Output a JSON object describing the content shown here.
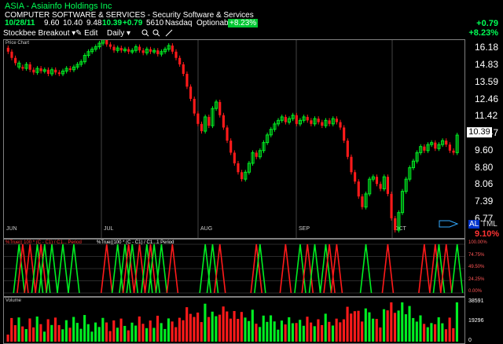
{
  "header": {
    "title": "ASIA - Asiainfo Holdings Inc",
    "sector": "COMPUTER SOFTWARE & SERVICES - Security Software & Services",
    "date": "10/28/11",
    "open": "9.60",
    "high": "10.40",
    "low": "9.48",
    "close": "10.39",
    "change": "+0.79",
    "volume": "5610",
    "exchange": "Nasdaq",
    "optionable": "Optionable",
    "pct_badge": "+8.23%",
    "change_right": "+0.79",
    "pct_right": "+8.23%"
  },
  "toolbar": {
    "layout": "Stockbee Breakout",
    "edit": "Edit",
    "period": "Daily",
    "icons": [
      "chevron-down-icon",
      "pencil-icon",
      "chevron-down-icon",
      "zoom-in-icon",
      "zoom-out-icon",
      "draw-line-icon"
    ]
  },
  "price_pane": {
    "label": "Price Chart",
    "price_tag": "10.39",
    "al": "AL",
    "tml": "TML",
    "pct": "9.10%"
  },
  "indicator_pane": {
    "label_red": "%True(( 100 * (C - C1) / C1... Period",
    "label_green": "%True((100 * (C - C1) / C1...1 Period",
    "levels": [
      "100.00%",
      "74.75%",
      "49.50%",
      "24.25%",
      "0.00%"
    ]
  },
  "volume_pane": {
    "label": "Volume",
    "levels": [
      "38591",
      "19296",
      "0"
    ]
  },
  "colors": {
    "up": "#00ee22",
    "down": "#ff1a1a",
    "text_green": "#00ff55"
  },
  "chart_data": {
    "type": "candlestick",
    "months": [
      "JUN",
      "JUL",
      "AUG",
      "SEP",
      "OCT"
    ],
    "y_ticks": [
      "16.18",
      "14.83",
      "13.59",
      "12.46",
      "11.42",
      "10.47",
      "9.60",
      "8.80",
      "8.06",
      "7.39",
      "6.77"
    ],
    "y_tick_values": [
      16.18,
      14.83,
      13.59,
      12.46,
      11.42,
      10.47,
      9.6,
      8.8,
      8.06,
      7.39,
      6.77
    ],
    "log_scale": true,
    "series_close": [
      15.9,
      15.4,
      15.0,
      14.7,
      14.6,
      14.9,
      14.5,
      14.3,
      14.6,
      14.4,
      14.5,
      14.2,
      14.5,
      14.3,
      14.2,
      14.4,
      14.6,
      14.5,
      14.7,
      14.9,
      15.1,
      15.6,
      15.9,
      16.1,
      16.3,
      16.6,
      16.9,
      16.5,
      16.3,
      16.0,
      16.2,
      16.0,
      16.1,
      15.9,
      16.0,
      16.3,
      16.0,
      15.8,
      16.1,
      15.9,
      16.0,
      15.7,
      15.9,
      16.1,
      16.4,
      15.9,
      15.4,
      14.9,
      14.2,
      13.3,
      12.5,
      11.6,
      11.0,
      10.6,
      11.4,
      10.9,
      11.9,
      12.3,
      11.5,
      10.8,
      10.1,
      9.5,
      9.0,
      8.6,
      8.3,
      8.6,
      9.0,
      9.5,
      9.3,
      9.6,
      10.0,
      10.4,
      10.7,
      11.0,
      11.2,
      11.4,
      11.1,
      11.3,
      11.5,
      11.0,
      11.2,
      11.4,
      11.2,
      11.0,
      11.3,
      11.1,
      10.9,
      11.2,
      11.0,
      11.3,
      11.1,
      10.8,
      10.1,
      9.3,
      8.6,
      8.2,
      7.6,
      7.2,
      7.7,
      8.3,
      8.4,
      8.1,
      7.9,
      8.4,
      7.7,
      6.8,
      6.4,
      7.0,
      7.8,
      8.3,
      8.8,
      9.1,
      9.5,
      9.8,
      9.6,
      9.9,
      10.0,
      9.7,
      9.9,
      10.1,
      9.9,
      9.6,
      9.5,
      10.39
    ],
    "series_direction": [
      "d",
      "d",
      "d",
      "u",
      "d",
      "u",
      "d",
      "d",
      "u",
      "d",
      "u",
      "d",
      "u",
      "d",
      "d",
      "u",
      "u",
      "d",
      "u",
      "u",
      "u",
      "u",
      "u",
      "u",
      "u",
      "u",
      "u",
      "d",
      "d",
      "d",
      "u",
      "d",
      "u",
      "d",
      "u",
      "u",
      "d",
      "d",
      "u",
      "d",
      "u",
      "d",
      "u",
      "u",
      "u",
      "d",
      "d",
      "d",
      "d",
      "d",
      "d",
      "d",
      "d",
      "d",
      "u",
      "d",
      "u",
      "u",
      "d",
      "d",
      "d",
      "d",
      "d",
      "d",
      "d",
      "u",
      "u",
      "u",
      "d",
      "u",
      "u",
      "u",
      "u",
      "u",
      "u",
      "u",
      "d",
      "u",
      "u",
      "d",
      "u",
      "u",
      "d",
      "d",
      "u",
      "d",
      "d",
      "u",
      "d",
      "u",
      "d",
      "d",
      "d",
      "d",
      "d",
      "d",
      "d",
      "d",
      "u",
      "u",
      "u",
      "d",
      "d",
      "u",
      "d",
      "d",
      "d",
      "u",
      "u",
      "u",
      "u",
      "u",
      "u",
      "u",
      "d",
      "u",
      "u",
      "d",
      "u",
      "u",
      "d",
      "d",
      "d",
      "u"
    ],
    "volume_max": 38591
  }
}
